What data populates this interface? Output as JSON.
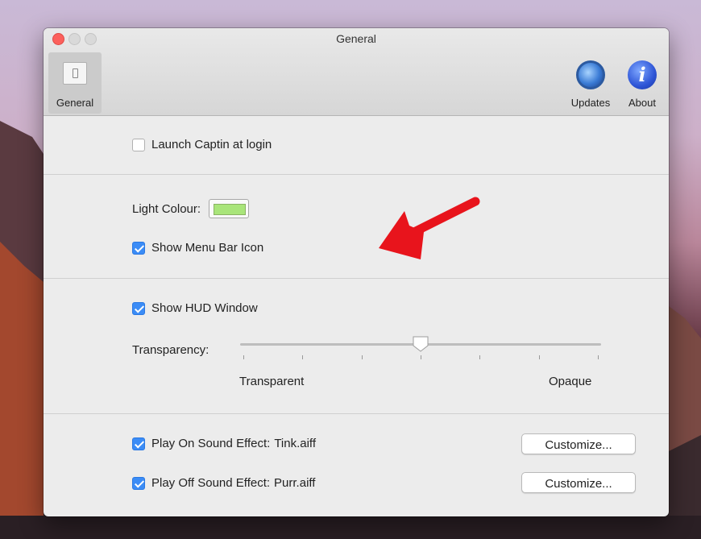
{
  "window": {
    "title": "General"
  },
  "toolbar": {
    "general_label": "General",
    "updates_label": "Updates",
    "about_label": "About",
    "about_glyph": "i"
  },
  "section1": {
    "launch_label": "Launch Captin at login",
    "launch_checked": false
  },
  "section2": {
    "light_colour_label": "Light Colour:",
    "light_colour_value": "#a9e57a",
    "show_menu_bar_label": "Show Menu Bar Icon",
    "show_menu_bar_checked": true
  },
  "section3": {
    "show_hud_label": "Show HUD Window",
    "show_hud_checked": true,
    "transparency_label": "Transparency:",
    "transparency_value": 0.5,
    "min_label": "Transparent",
    "max_label": "Opaque"
  },
  "section4": {
    "play_on_label": "Play On Sound Effect:",
    "play_on_file": "Tink.aiff",
    "play_on_checked": true,
    "play_off_label": "Play Off Sound Effect:",
    "play_off_file": "Purr.aiff",
    "play_off_checked": true,
    "customize_label": "Customize..."
  },
  "colors": {
    "accent": "#3b8cf6",
    "annotation_arrow": "#e8141c"
  }
}
